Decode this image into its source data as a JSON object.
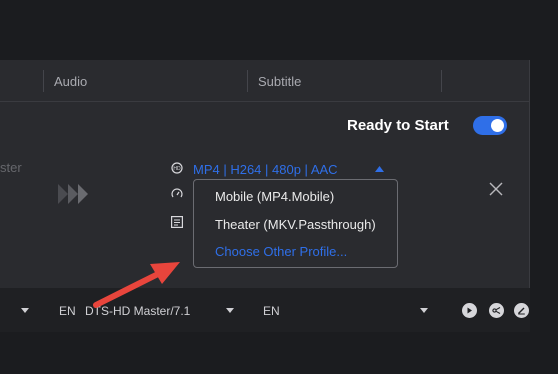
{
  "columns": {
    "audio": "Audio",
    "subtitle": "Subtitle"
  },
  "ready": {
    "label": "Ready to Start",
    "enabled": true
  },
  "source": {
    "name_fragment": "ster"
  },
  "profile": {
    "current": "MP4 | H264 | 480p | AAC",
    "options": [
      "Mobile (MP4.Mobile)",
      "Theater (MKV.Passthrough)"
    ],
    "choose_other": "Choose Other Profile..."
  },
  "bottom": {
    "audio_lang": "EN",
    "audio_track": "DTS-HD Master/7.1",
    "subtitle_lang": "EN"
  },
  "colors": {
    "accent": "#2f6fe8",
    "annotation_arrow": "#e8453c"
  },
  "icons": [
    "hd-icon",
    "speed-icon",
    "list-icon",
    "chevron-up-icon",
    "close-icon",
    "play-icon",
    "scissors-icon",
    "edit-icon"
  ]
}
